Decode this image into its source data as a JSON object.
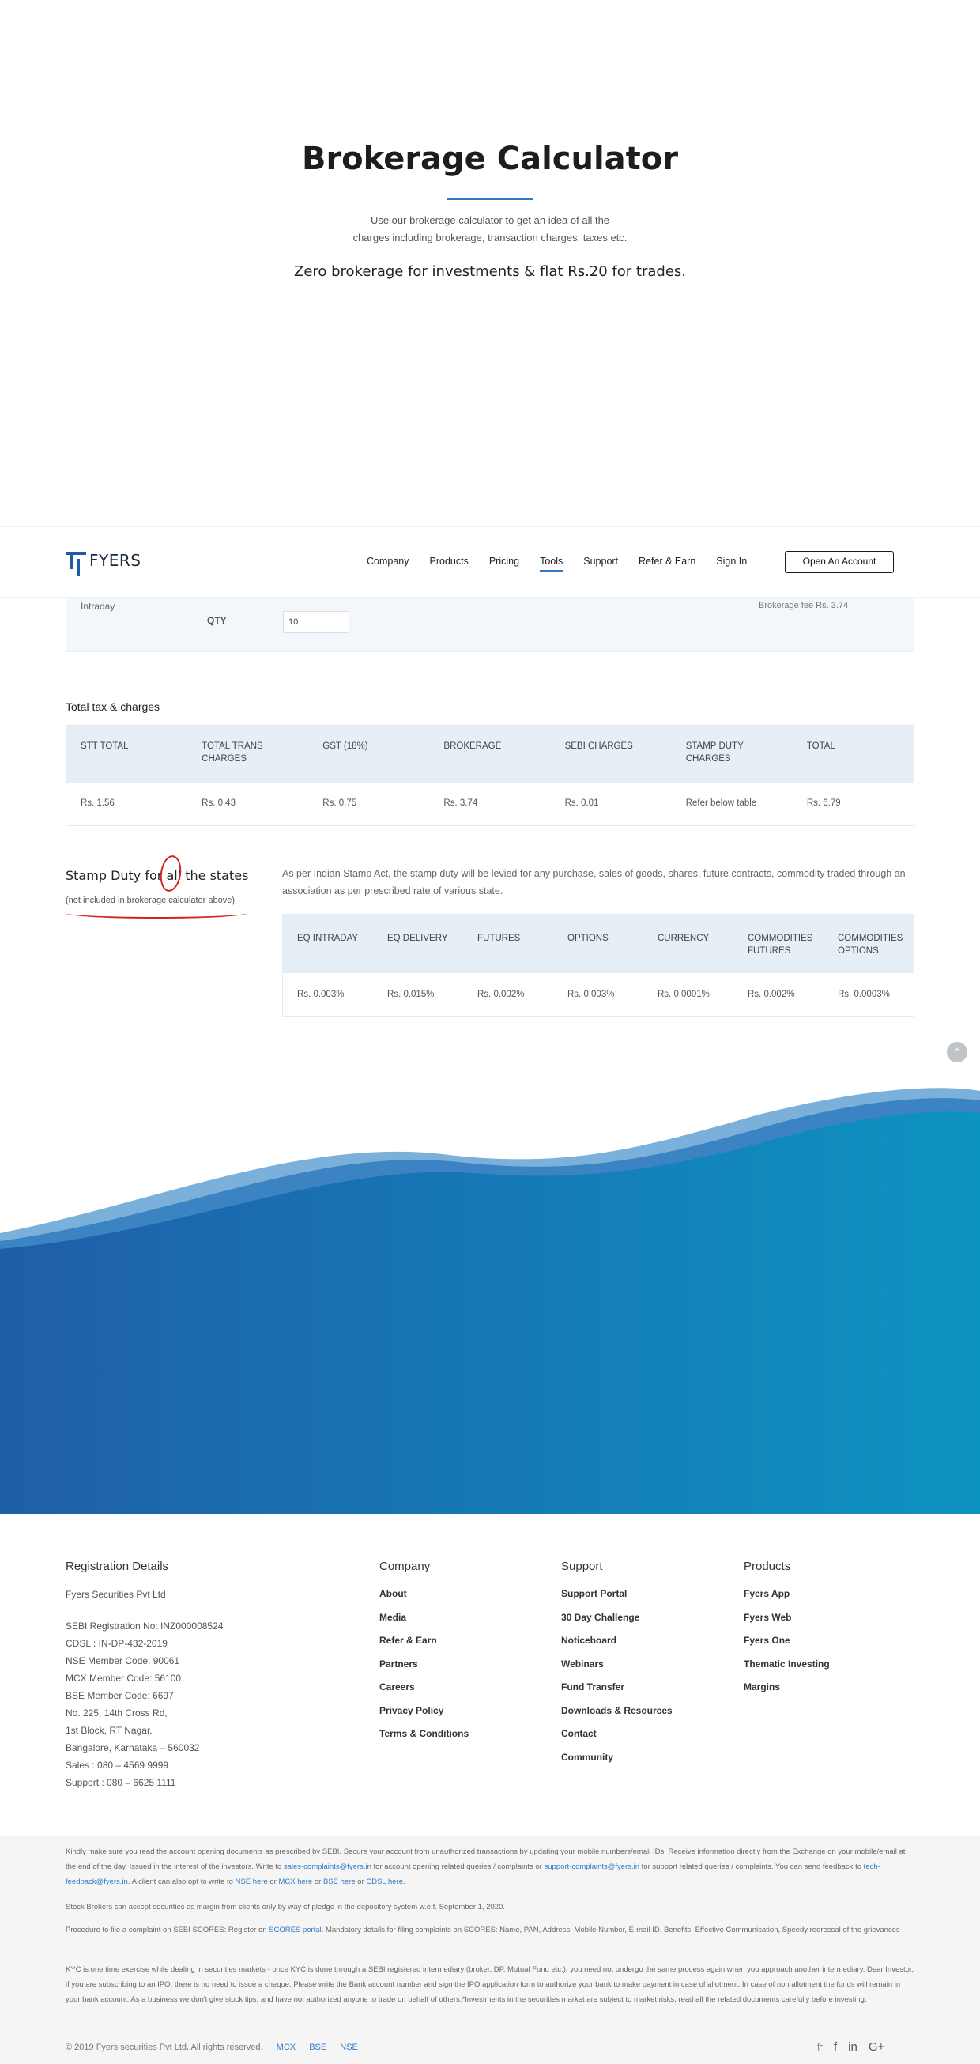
{
  "hero": {
    "title": "Brokerage Calculator",
    "desc_line1": "Use our brokerage calculator to get an idea of all the",
    "desc_line2": "charges including brokerage, transaction charges, taxes etc.",
    "zero_brokerage": "Zero brokerage for investments & flat Rs.20 for trades."
  },
  "calc_partial": {
    "segment": "Intraday",
    "qty_label": "QTY",
    "qty_value": "10",
    "brokerage_fee": "Brokerage fee Rs. 3.74"
  },
  "nav": {
    "logo": "FYERS",
    "links": [
      "Company",
      "Products",
      "Pricing",
      "Tools",
      "Support",
      "Refer & Earn",
      "Sign In"
    ],
    "active": "Tools",
    "cta": "Open An Account"
  },
  "tax": {
    "title": "Total tax & charges",
    "headers": [
      "STT TOTAL",
      "TOTAL TRANS CHARGES",
      "GST (18%)",
      "BROKERAGE",
      "SEBI CHARGES",
      "STAMP DUTY CHARGES",
      "TOTAL"
    ],
    "values": [
      "Rs. 1.56",
      "Rs. 0.43",
      "Rs. 0.75",
      "Rs. 3.74",
      "Rs. 0.01",
      "Refer below table",
      "Rs. 6.79"
    ]
  },
  "stamp": {
    "title": "Stamp Duty for all the states",
    "note": "(not included in brokerage calculator above)",
    "desc": "As per Indian Stamp Act, the stamp duty will be levied for any purchase, sales of goods, shares, future contracts, commodity traded through an association as per prescribed rate of various state.",
    "headers": [
      "EQ INTRADAY",
      "EQ DELIVERY",
      "FUTURES",
      "OPTIONS",
      "CURRENCY",
      "COMMODITIES FUTURES",
      "COMMODITIES OPTIONS"
    ],
    "values": [
      "Rs. 0.003%",
      "Rs. 0.015%",
      "Rs. 0.002%",
      "Rs. 0.003%",
      "Rs. 0.0001%",
      "Rs. 0.002%",
      "Rs. 0.0003%"
    ]
  },
  "footer": {
    "registration_title": "Registration Details",
    "registration_lines": [
      "Fyers Securities Pvt Ltd",
      "",
      "SEBI Registration No: INZ000008524",
      "CDSL : IN-DP-432-2019",
      "NSE Member Code: 90061",
      "MCX Member Code: 56100",
      "BSE Member Code: 6697",
      "No. 225, 14th Cross Rd,",
      "1st Block, RT Nagar,",
      "Bangalore, Karnataka – 560032",
      "Sales : 080 – 4569 9999",
      "Support : 080 – 6625 1111"
    ],
    "company_title": "Company",
    "company_links": [
      "About",
      "Media",
      "Refer & Earn",
      "Partners",
      "Careers",
      "Privacy Policy",
      "Terms & Conditions"
    ],
    "support_title": "Support",
    "support_links": [
      "Support Portal",
      "30 Day Challenge",
      "Noticeboard",
      "Webinars",
      "Fund Transfer",
      "Downloads & Resources",
      "Contact",
      "Community"
    ],
    "products_title": "Products",
    "products_links": [
      "Fyers App",
      "Fyers Web",
      "Fyers One",
      "Thematic Investing",
      "Margins"
    ]
  },
  "disclaimer": {
    "p1a": "Kindly make sure you read the account opening documents as prescribed by SEBI. Secure your account from unauthorized transactions by updating your mobile numbers/email IDs. Receive information directly from the Exchange on your mobile/email at the end of the day. Issued in the interest of the investors. Write to",
    "p1_link1": "sales-complaints@fyers.in",
    "p1b": "for account opening related queries / complaints or",
    "p1_link2": "support-complaints@fyers.in",
    "p1c": "for support related queries / complaints. You can send feedback to",
    "p1_link3": "tech-feedback@fyers.in",
    "p1d": ". A client can also opt to write to",
    "p1_link4": "NSE here",
    "p1e": "or",
    "p1_link5": "MCX here",
    "p1f": "or",
    "p1_link6": "BSE here",
    "p1g": "or",
    "p1_link7": "CDSL here",
    "p1h": ".",
    "p2": "Stock Brokers can accept securities as margin from clients only by way of pledge in the depository system w.e.f. September 1, 2020.",
    "p3a": "Procedure to file a complaint on SEBI SCORES: Register on",
    "p3_link": "SCORES portal",
    "p3b": ". Mandatory details for filing complaints on SCORES: Name, PAN, Address, Mobile Number, E-mail ID. Benefits: Effective Communication, Speedy redressal of the grievances",
    "p4": "KYC is one time exercise while dealing in securities markets - once KYC is done through a SEBI registered intermediary (broker, DP, Mutual Fund etc.), you need not undergo the same process again when you approach another intermediary. Dear Investor, if you are subscribing to an IPO, there is no need to issue a cheque. Please write the Bank account number and sign the IPO application form to authorize your bank to make payment in case of allotment. In case of non allotment the funds will remain in your bank account. As a business we don't give stock tips, and have not authorized anyone to trade on behalf of others.*Investments in the securities market are subject to market risks, read all the related documents carefully before investing.",
    "copyright": "© 2019 Fyers securities Pvt Ltd. All rights reserved.",
    "exch_links": [
      "MCX",
      "BSE",
      "NSE"
    ]
  },
  "colors": {
    "accent": "#2e7bc4",
    "wave_top": "#1b5ea8",
    "wave_bottom": "#1196c4",
    "table_head": "#e6eef6",
    "annotation_red": "#d02525"
  },
  "icons": [
    "scroll-top-icon",
    "twitter-icon",
    "facebook-icon",
    "linkedin-icon",
    "google-plus-icon"
  ]
}
